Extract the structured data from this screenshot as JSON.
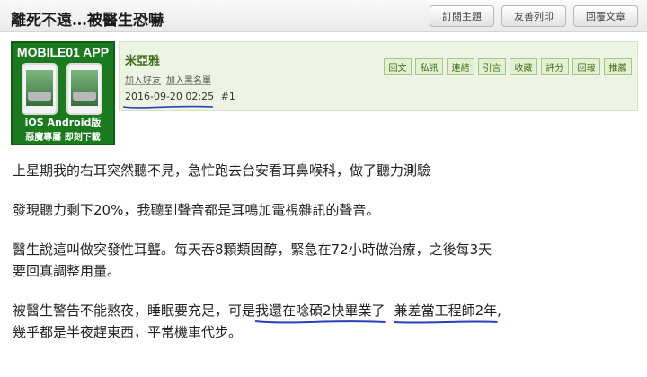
{
  "thread": {
    "title": "離死不遠…被醫生恐嚇",
    "buttons": [
      "訂閱主題",
      "友善列印",
      "回覆文章"
    ]
  },
  "ad": {
    "top_text": "MOBILE01 APP",
    "os_text": "iOS Android版",
    "cta_text": "惡魔專屬 即刻下載",
    "brand_color": "#1b7a1e"
  },
  "post": {
    "author": "米亞雅",
    "links": [
      "加入好友",
      "加入黑名單"
    ],
    "date": "2016-09-20 02:25",
    "number": "#1",
    "actions": [
      "回文",
      "私訊",
      "連結",
      "引言",
      "收藏",
      "評分",
      "回報",
      "推薦"
    ],
    "highlight_color": "#2a3fb8"
  },
  "content": {
    "p1": "上星期我的右耳突然聽不見，急忙跑去台安看耳鼻喉科，做了聽力測驗",
    "p2": "發現聽力剩下20%，我聽到聲音都是耳鳴加電視雜訊的聲音。",
    "p3a": "醫生說這叫做突發性耳聾。每天吞8顆類固醇，緊急在72小時做治療，之後每3天",
    "p3b": "要回真調整用量。",
    "p4_pre": "被醫生警告不能熬夜，睡眠要充足，可是",
    "p4_u1": "我還在唸碩2快畢業了",
    "p4_u2": "兼差當工程師2年",
    "p4_end": ",",
    "p5": "幾乎都是半夜趕東西，平常機車代步。"
  }
}
